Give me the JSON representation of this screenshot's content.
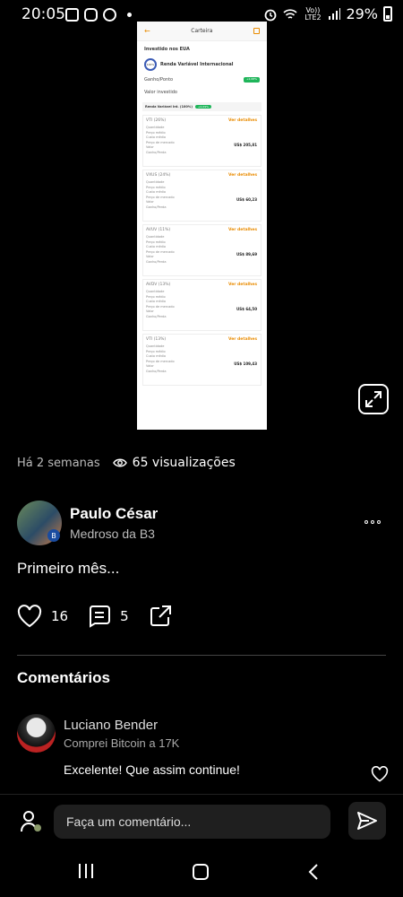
{
  "status_bar": {
    "time": "20:05",
    "network": "Vo)) LTE2",
    "battery": "29%"
  },
  "post_image": {
    "title": "Carteira",
    "section": "Investido nos EUA",
    "group_name": "Renda Variável Internacional",
    "group_percent": "100%",
    "gain_label": "Ganho/Ponto",
    "gain_value": "+2,68%",
    "invested_label": "Valor investido",
    "sub_label": "Renda Variável Int. (100%)",
    "sub_value": "+2,09%",
    "detail_link": "Ver detalhes",
    "row_labels": [
      "Quantidade",
      "Preço médio",
      "Custo médio",
      "Preço de mercado",
      "Valor",
      "Ganho/Perda"
    ],
    "cards": [
      {
        "name": "VTI (26%)",
        "value": "US$ 205,81"
      },
      {
        "name": "VXUS (24%)",
        "value": "US$ 60,23"
      },
      {
        "name": "AVUV (11%)",
        "value": "US$ 89,69"
      },
      {
        "name": "AVDV (13%)",
        "value": "US$ 64,50"
      },
      {
        "name": "VTI (13%)",
        "value": "US$ 109,43"
      }
    ]
  },
  "meta": {
    "posted": "Há 2 semanas",
    "views": "65 visualizações"
  },
  "author": {
    "name": "Paulo César",
    "subtitle": "Medroso da B3",
    "badge": "B"
  },
  "post": {
    "text": "Primeiro mês..."
  },
  "actions": {
    "likes": "16",
    "comments": "5"
  },
  "comments": {
    "title": "Comentários",
    "items": [
      {
        "name": "Luciano Bender",
        "subtitle": "Comprei Bitcoin a 17K",
        "text": "Excelente!  Que assim continue!"
      }
    ]
  },
  "composer": {
    "placeholder": "Faça um comentário..."
  },
  "colors": {
    "background": "#000000",
    "accent_orange": "#e98b00",
    "positive_green": "#1fb55a",
    "input_bg": "#1f1f1f"
  }
}
